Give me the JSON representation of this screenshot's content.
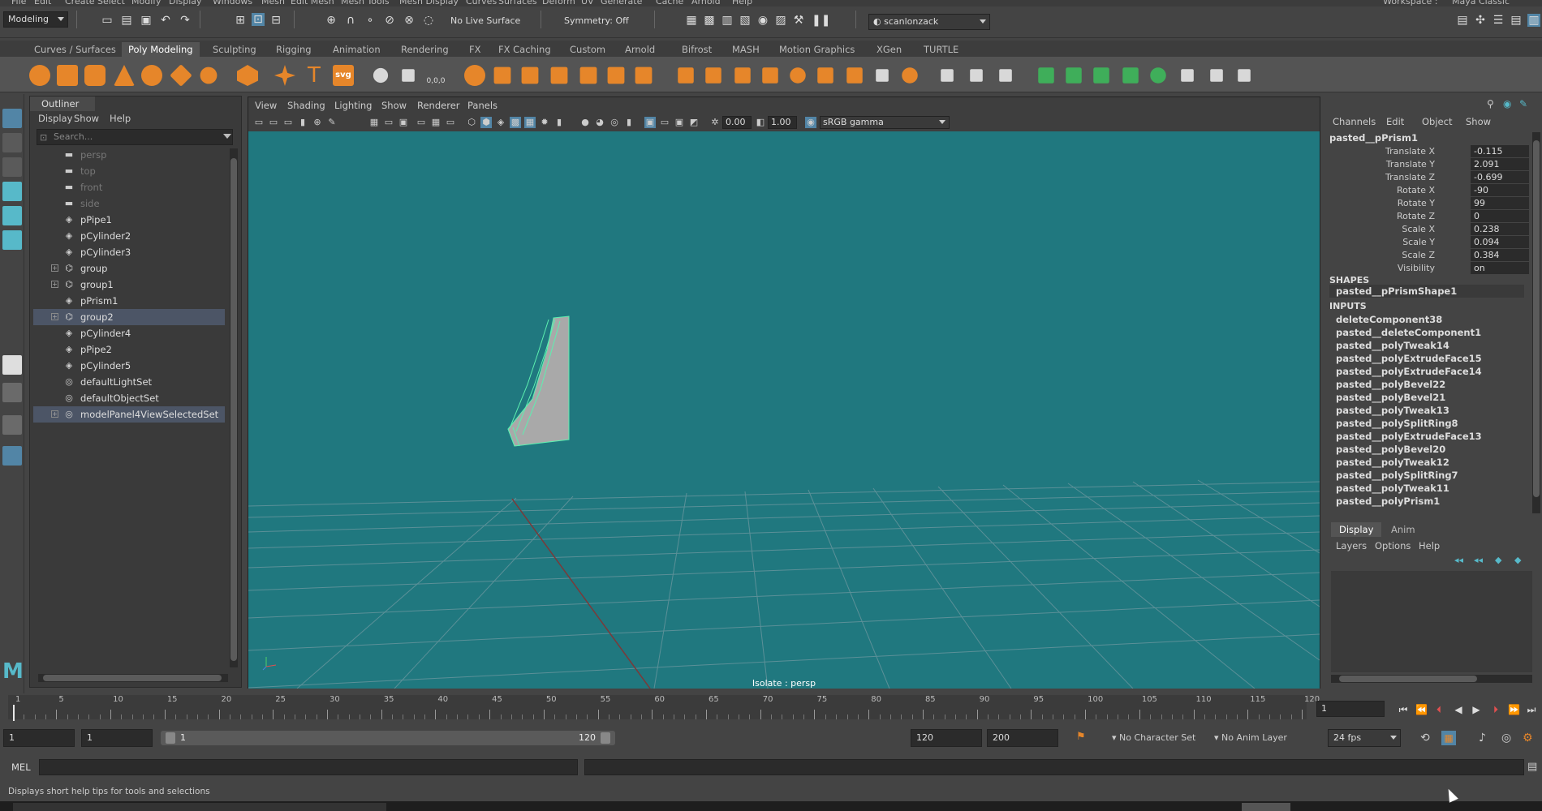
{
  "menubar": {
    "items": [
      "File",
      "Edit",
      "Create",
      "Select",
      "Modify",
      "Display",
      "Windows",
      "Mesh",
      "Edit Mesh",
      "Mesh Tools",
      "Mesh Display",
      "Curves",
      "Surfaces",
      "Deform",
      "UV",
      "Generate",
      "Cache",
      "Arnold",
      "Help"
    ],
    "workspace_label": "Workspace :",
    "workspace_value": "Maya Classic"
  },
  "statusline": {
    "mode": "Modeling",
    "live_surface": "No Live Surface",
    "symmetry": "Symmetry: Off",
    "user": "scanlonzack"
  },
  "shelf": {
    "tabs": [
      "Curves / Surfaces",
      "Poly Modeling",
      "Sculpting",
      "Rigging",
      "Animation",
      "Rendering",
      "FX",
      "FX Caching",
      "Custom",
      "Arnold",
      "Bifrost",
      "MASH",
      "Motion Graphics",
      "XGen",
      "TURTLE"
    ],
    "active_tab": "Poly Modeling",
    "text_tool_label": "T",
    "svg_tool_label": "svg",
    "uv_tool_label": "0,0,0"
  },
  "outliner": {
    "title": "Outliner",
    "menu": [
      "Display",
      "Show",
      "Help"
    ],
    "search_placeholder": "Search...",
    "rows": [
      {
        "label": "persp",
        "icon": "camera-icon",
        "dim": true,
        "expand": false,
        "selected": false
      },
      {
        "label": "top",
        "icon": "camera-icon",
        "dim": true,
        "expand": false,
        "selected": false
      },
      {
        "label": "front",
        "icon": "camera-icon",
        "dim": true,
        "expand": false,
        "selected": false
      },
      {
        "label": "side",
        "icon": "camera-icon",
        "dim": true,
        "expand": false,
        "selected": false
      },
      {
        "label": "pPipe1",
        "icon": "mesh-icon",
        "dim": false,
        "expand": false,
        "selected": false
      },
      {
        "label": "pCylinder2",
        "icon": "mesh-icon",
        "dim": false,
        "expand": false,
        "selected": false
      },
      {
        "label": "pCylinder3",
        "icon": "mesh-icon",
        "dim": false,
        "expand": false,
        "selected": false
      },
      {
        "label": "group",
        "icon": "group-icon",
        "dim": false,
        "expand": true,
        "selected": false
      },
      {
        "label": "group1",
        "icon": "group-icon",
        "dim": false,
        "expand": true,
        "selected": false
      },
      {
        "label": "pPrism1",
        "icon": "mesh-icon",
        "dim": false,
        "expand": false,
        "selected": false
      },
      {
        "label": "group2",
        "icon": "group-icon",
        "dim": false,
        "expand": true,
        "selected": true
      },
      {
        "label": "pCylinder4",
        "icon": "mesh-icon",
        "dim": false,
        "expand": false,
        "selected": false
      },
      {
        "label": "pPipe2",
        "icon": "mesh-icon",
        "dim": false,
        "expand": false,
        "selected": false
      },
      {
        "label": "pCylinder5",
        "icon": "mesh-icon",
        "dim": false,
        "expand": false,
        "selected": false
      },
      {
        "label": "defaultLightSet",
        "icon": "set-icon",
        "dim": false,
        "expand": false,
        "selected": false
      },
      {
        "label": "defaultObjectSet",
        "icon": "set-icon",
        "dim": false,
        "expand": false,
        "selected": false
      },
      {
        "label": "modelPanel4ViewSelectedSet",
        "icon": "set-icon",
        "dim": false,
        "expand": true,
        "selected": true
      }
    ]
  },
  "viewport": {
    "menu": [
      "View",
      "Shading",
      "Lighting",
      "Show",
      "Renderer",
      "Panels"
    ],
    "exposure": "0.00",
    "gamma": "1.00",
    "color_space": "sRGB gamma",
    "label": "Isolate : persp",
    "bg_color": "#20787f"
  },
  "channelbox": {
    "menu": [
      "Channels",
      "Edit",
      "Object",
      "Show"
    ],
    "object": "pasted__pPrism1",
    "attributes": [
      {
        "name": "Translate X",
        "value": "-0.115"
      },
      {
        "name": "Translate Y",
        "value": "2.091"
      },
      {
        "name": "Translate Z",
        "value": "-0.699"
      },
      {
        "name": "Rotate X",
        "value": "-90"
      },
      {
        "name": "Rotate Y",
        "value": "99"
      },
      {
        "name": "Rotate Z",
        "value": "0"
      },
      {
        "name": "Scale X",
        "value": "0.238"
      },
      {
        "name": "Scale Y",
        "value": "0.094"
      },
      {
        "name": "Scale Z",
        "value": "0.384"
      },
      {
        "name": "Visibility",
        "value": "on"
      }
    ],
    "shapes_header": "SHAPES",
    "shape": "pasted__pPrismShape1",
    "inputs_header": "INPUTS",
    "inputs": [
      "deleteComponent38",
      "pasted__deleteComponent1",
      "pasted__polyTweak14",
      "pasted__polyExtrudeFace15",
      "pasted__polyExtrudeFace14",
      "pasted__polyBevel22",
      "pasted__polyBevel21",
      "pasted__polyTweak13",
      "pasted__polySplitRing8",
      "pasted__polyExtrudeFace13",
      "pasted__polyBevel20",
      "pasted__polyTweak12",
      "pasted__polySplitRing7",
      "pasted__polyTweak11",
      "pasted__polyPrism1"
    ]
  },
  "layers": {
    "tabs": [
      "Display",
      "Anim"
    ],
    "active_tab": "Display",
    "menu": [
      "Layers",
      "Options",
      "Help"
    ]
  },
  "timeslider": {
    "labels": [
      "1",
      "5",
      "10",
      "15",
      "20",
      "25",
      "30",
      "35",
      "40",
      "45",
      "50",
      "55",
      "60",
      "65",
      "70",
      "75",
      "80",
      "85",
      "90",
      "95",
      "100",
      "105",
      "110",
      "115",
      "120"
    ],
    "current_frame": "1"
  },
  "rangeslider": {
    "start": "1",
    "anim_start": "1",
    "range_start": "1",
    "range_end": "120",
    "end": "120",
    "anim_end": "200",
    "character_set": "No Character Set",
    "anim_layer": "No Anim Layer",
    "fps": "24 fps"
  },
  "cmdline": {
    "mode": "MEL"
  },
  "helpline": {
    "text": "Displays short help tips for tools and selections"
  }
}
